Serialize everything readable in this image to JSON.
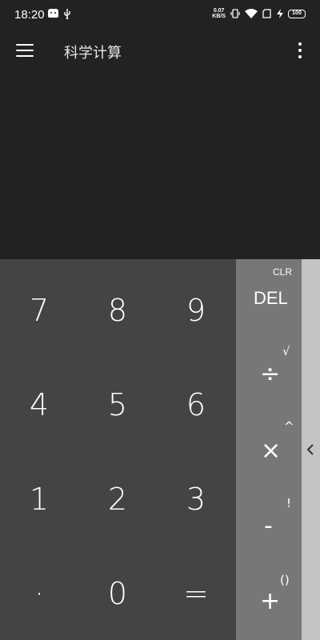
{
  "status_bar": {
    "time": "18:20",
    "net_speed_value": "0.07",
    "net_speed_unit": "KB/S",
    "battery": "100",
    "icons": [
      "android-icon",
      "usb-icon",
      "vibrate-icon",
      "wifi-icon",
      "sim-icon",
      "charging-icon",
      "battery-icon"
    ]
  },
  "app_bar": {
    "title": "科学计算",
    "icons": [
      "menu-icon",
      "more-icon"
    ]
  },
  "keypad": {
    "numbers": [
      {
        "label": "7"
      },
      {
        "label": "8"
      },
      {
        "label": "9"
      },
      {
        "label": "4"
      },
      {
        "label": "5"
      },
      {
        "label": "6"
      },
      {
        "label": "1"
      },
      {
        "label": "2"
      },
      {
        "label": "3"
      },
      {
        "label": "·"
      },
      {
        "label": "0"
      },
      {
        "label": "="
      }
    ],
    "ops": {
      "clr": "CLR",
      "del": "DEL",
      "divide": "÷",
      "sqrt": "√",
      "multiply": "×",
      "power": "^",
      "minus": "-",
      "factorial": "!",
      "plus": "+",
      "parens": "()"
    }
  },
  "colors": {
    "background": "#222222",
    "numpad": "#444444",
    "ops_panel": "#777777",
    "side_panel": "#c4c4c4"
  }
}
